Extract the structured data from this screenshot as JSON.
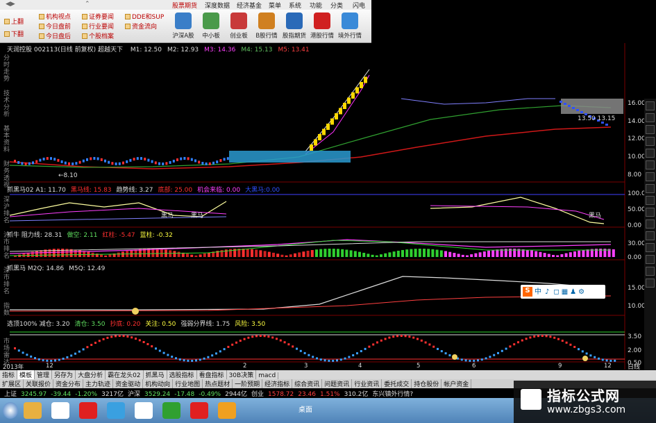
{
  "menu": {
    "items": [
      "股票期货",
      "深度数据",
      "经济基金",
      "菜单",
      "系统",
      "功能",
      "分类",
      "闪电"
    ]
  },
  "toolbar": {
    "prev": "上翻",
    "next": "下翻",
    "col1": [
      "机构视点",
      "今日盘前",
      "今日盘后"
    ],
    "col2": [
      "证券要闻",
      "行业要闻",
      "个股档案"
    ],
    "col3": [
      "DDE和SUP",
      "资金流向"
    ],
    "big": [
      "沪深A股",
      "中小板",
      "创业板",
      "B股行情",
      "股指期货",
      "港股行情",
      "境外行情"
    ]
  },
  "stock": {
    "title": "天润控股 002113(日线 前复权) 超越天下",
    "ma": [
      {
        "label": "M1: 12.50",
        "color": "#dddddd"
      },
      {
        "label": "M2: 12.93",
        "color": "#dddddd"
      },
      {
        "label": "M3: 14.36",
        "color": "#ff40ff"
      },
      {
        "label": "M4: 15.13",
        "color": "#60c060"
      },
      {
        "label": "M5: 13.41",
        "color": "#ff4040"
      }
    ],
    "axis": [
      "16.00",
      "14.00",
      "12.00",
      "10.00",
      "8.00"
    ],
    "low_label": "8.10",
    "hi_labels": [
      "13.50",
      "13.15"
    ]
  },
  "left_strip": [
    "分时走势",
    "技术分析",
    "基本资料",
    "财务透视",
    "深沪排名",
    "沪市排名",
    "深市排名",
    "指数",
    "市场雷达"
  ],
  "panel2": {
    "items": [
      {
        "t": "抓黑马02 A1: 11.70",
        "c": "#dddddd"
      },
      {
        "t": "黑马线: 15.83",
        "c": "#ff3030"
      },
      {
        "t": "趋势线: 3.27",
        "c": "#dddddd"
      },
      {
        "t": "底部: 25.00",
        "c": "#ff3030"
      },
      {
        "t": "机会来临: 0.00",
        "c": "#ff40ff"
      },
      {
        "t": "大黑马:0.00",
        "c": "#3050ff"
      }
    ],
    "axis": [
      "100.00",
      "50.00",
      "0.00"
    ],
    "labels": [
      "黑马",
      "黑马",
      "黑马",
      "黑马"
    ]
  },
  "panel3": {
    "items": [
      {
        "t": "抓牛 阻力线: 28.31",
        "c": "#dddddd"
      },
      {
        "t": "做空: 2.11",
        "c": "#60e060"
      },
      {
        "t": "红柱: -5.47",
        "c": "#ff3030"
      },
      {
        "t": "蓝柱: -0.32",
        "c": "#ffff40"
      }
    ],
    "axis": [
      "30.00",
      "0.00"
    ]
  },
  "panel4": {
    "items": [
      {
        "t": "抓黑马 M2Q: 14.86",
        "c": "#dddddd"
      },
      {
        "t": "M5Q: 12.49",
        "c": "#dddddd"
      }
    ],
    "axis": [
      "15.00",
      "10.00"
    ]
  },
  "panel5": {
    "items": [
      {
        "t": "选顶100% 减仓: 3.20",
        "c": "#dddddd"
      },
      {
        "t": "清仓: 3.50",
        "c": "#60e060"
      },
      {
        "t": "抄底: 0.20",
        "c": "#ff3030"
      },
      {
        "t": "关注: 0.50",
        "c": "#ffff40"
      },
      {
        "t": "强弱分界线: 1.75",
        "c": "#dddddd"
      },
      {
        "t": "风险: 3.50",
        "c": "#ffff40"
      }
    ],
    "axis": [
      "3.50",
      "2.00",
      "0.50"
    ]
  },
  "xaxis": [
    "2013年",
    "12",
    "2",
    "3",
    "4",
    "5",
    "6",
    "9",
    "12"
  ],
  "tabs1": [
    "指标",
    "模板",
    "管理",
    "另存为",
    "大盘分析",
    "霸在龙头02",
    "抓黑马",
    "选股指标",
    "看盘指标",
    "30B决策",
    "macd"
  ],
  "tabs1_active": 1,
  "tabs2": [
    "扩展区",
    "关联报价",
    "资金分布",
    "主力轨迹",
    "资金驱动",
    "机构动向",
    "行业地图",
    "热点题材",
    "一阶预期",
    "经济指标",
    "综合资讯",
    "问题资讯",
    "行业资讯",
    "委托成交",
    "持仓股份",
    "帐户资金"
  ],
  "status": {
    "sh_label": "上证",
    "sh": "3245.97",
    "sh_chg": "-39.44",
    "sh_pct": "-1.20%",
    "sh_amt": "3217亿",
    "sz_label": "沪深",
    "sz": "3529.24",
    "sz_chg": "-17.48",
    "sz_pct": "-0.49%",
    "sz_amt": "2944亿",
    "cy_label": "创业",
    "cy": "1578.72",
    "cy_chg": "23.46",
    "cy_pct": "1.51%",
    "cy_amt": "310.2亿",
    "news": "东兴镇外行情?"
  },
  "overlay": {
    "chars": [
      "S",
      "中",
      "♪"
    ]
  },
  "watermark": {
    "title": "指标公式网",
    "url": "www.zbgs3.com"
  },
  "rightaxis": {
    "label": "日线"
  }
}
